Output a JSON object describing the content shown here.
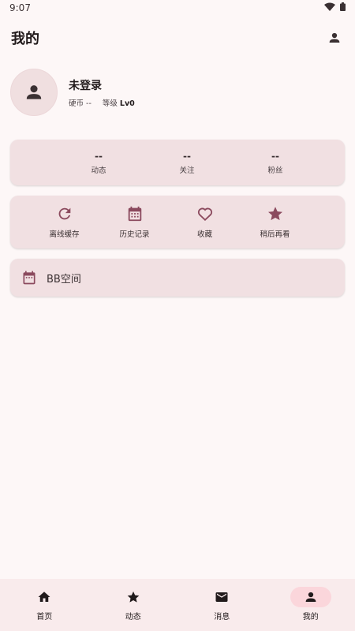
{
  "status_bar": {
    "time": "9:07"
  },
  "app_bar": {
    "title": "我的"
  },
  "profile": {
    "name": "未登录",
    "coins_label": "硬币 --",
    "level_prefix": "等级 ",
    "level_value": "Lv0"
  },
  "stats": [
    {
      "value": "--",
      "label": "动态"
    },
    {
      "value": "--",
      "label": "关注"
    },
    {
      "value": "--",
      "label": "粉丝"
    }
  ],
  "actions": [
    {
      "label": "离线缓存",
      "icon": "refresh-icon"
    },
    {
      "label": "历史记录",
      "icon": "calendar-icon"
    },
    {
      "label": "收藏",
      "icon": "heart-icon"
    },
    {
      "label": "稍后再看",
      "icon": "star-icon"
    }
  ],
  "bbspace": {
    "label": "BB空间",
    "icon": "calendar-icon"
  },
  "bottom_nav": [
    {
      "label": "首页",
      "icon": "home-icon",
      "active": false
    },
    {
      "label": "动态",
      "icon": "star-icon",
      "active": false
    },
    {
      "label": "消息",
      "icon": "mail-icon",
      "active": false
    },
    {
      "label": "我的",
      "icon": "person-icon",
      "active": true
    }
  ],
  "colors": {
    "background": "#fdf7f7",
    "card": "#f1e0e2",
    "accent": "#8b4a5e",
    "nav_active_pill": "#fbd6db",
    "text_primary": "#211a1b"
  }
}
